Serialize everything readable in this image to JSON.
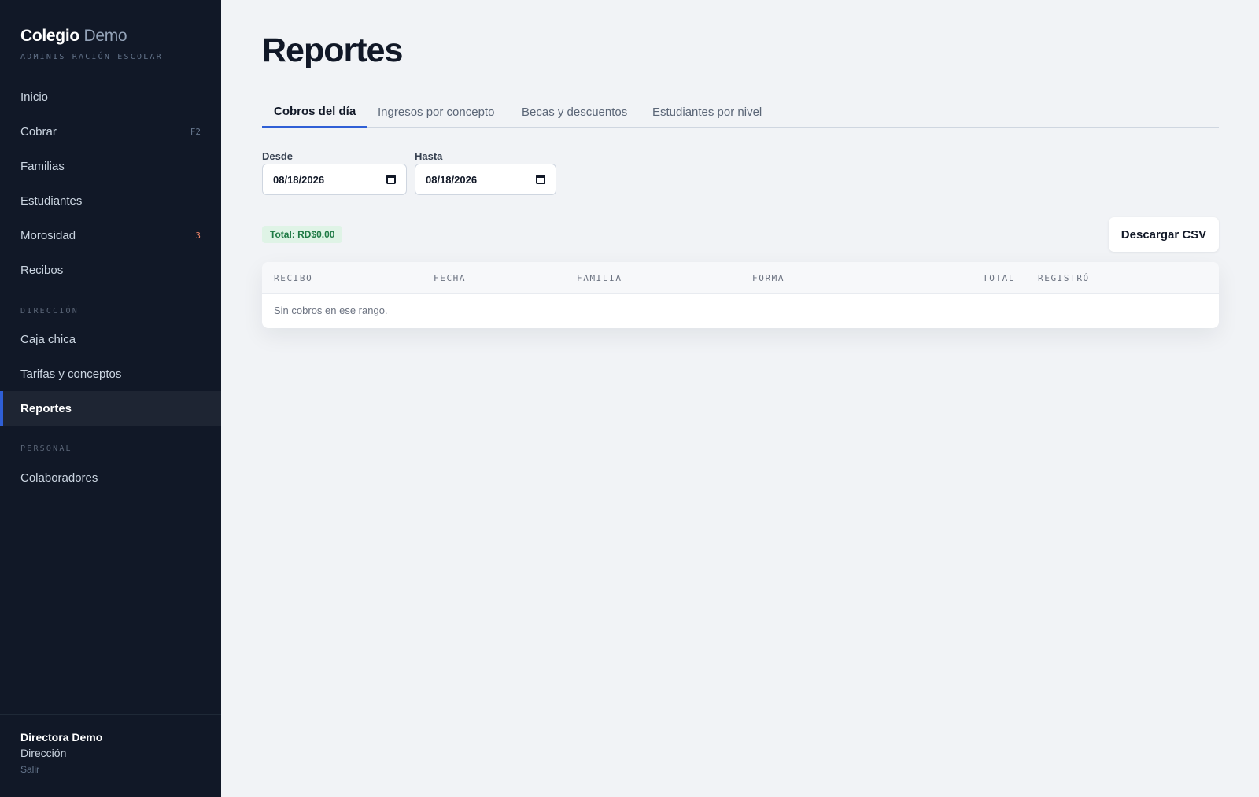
{
  "brand": {
    "name_bold": "Colegio",
    "name_light": "Demo",
    "subtitle": "ADMINISTRACIÓN ESCOLAR"
  },
  "nav": {
    "items": [
      {
        "label": "Inicio"
      },
      {
        "label": "Cobrar",
        "badge": "F2"
      },
      {
        "label": "Familias"
      },
      {
        "label": "Estudiantes"
      },
      {
        "label": "Morosidad",
        "badge": "3"
      },
      {
        "label": "Recibos"
      }
    ],
    "section_direccion": "DIRECCIÓN",
    "direccion_items": [
      {
        "label": "Caja chica"
      },
      {
        "label": "Tarifas y conceptos"
      },
      {
        "label": "Reportes",
        "active": true
      }
    ],
    "section_personal": "PERSONAL",
    "personal_items": [
      {
        "label": "Colaboradores"
      }
    ]
  },
  "user": {
    "name": "Directora Demo",
    "role": "Dirección",
    "logout": "Salir"
  },
  "page": {
    "title": "Reportes"
  },
  "tabs": [
    {
      "label": "Cobros del día",
      "active": true
    },
    {
      "label": "Ingresos por concepto"
    },
    {
      "label": "Becas y descuentos"
    },
    {
      "label": "Estudiantes por nivel"
    }
  ],
  "filters": {
    "desde_label": "Desde",
    "desde_value": "08/18/2026",
    "hasta_label": "Hasta",
    "hasta_value": "08/18/2026"
  },
  "summary": {
    "total": "Total: RD$0.00"
  },
  "actions": {
    "csv_label": "Descargar CSV"
  },
  "table": {
    "columns": [
      "RECIBO",
      "FECHA",
      "FAMILIA",
      "FORMA",
      "TOTAL",
      "REGISTRÓ"
    ],
    "empty_text": "Sin cobros en ese rango."
  },
  "colors": {
    "sidebar_bg": "#111827",
    "accent": "#2f5fd6",
    "page_bg": "#f1f3f6",
    "success": "#1f7a45",
    "alert": "#f0866a"
  },
  "icons": {
    "date_picker": "calendar-icon"
  }
}
